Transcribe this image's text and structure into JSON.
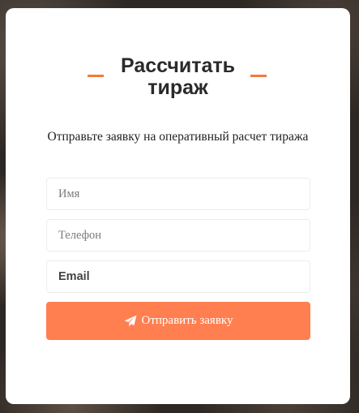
{
  "form": {
    "title": "Рассчитать тираж",
    "subtitle": "Отправьте заявку на оперативный расчет тиража",
    "fields": {
      "name_placeholder": "Имя",
      "phone_placeholder": "Телефон",
      "email_placeholder": "Email"
    },
    "submit_label": "Отправить заявку",
    "submit_icon": "paper-plane-icon"
  },
  "colors": {
    "accent": "#ff7f50",
    "dash": "#f07c3f",
    "title": "#2a2a2a",
    "card_bg": "#ffffff"
  }
}
